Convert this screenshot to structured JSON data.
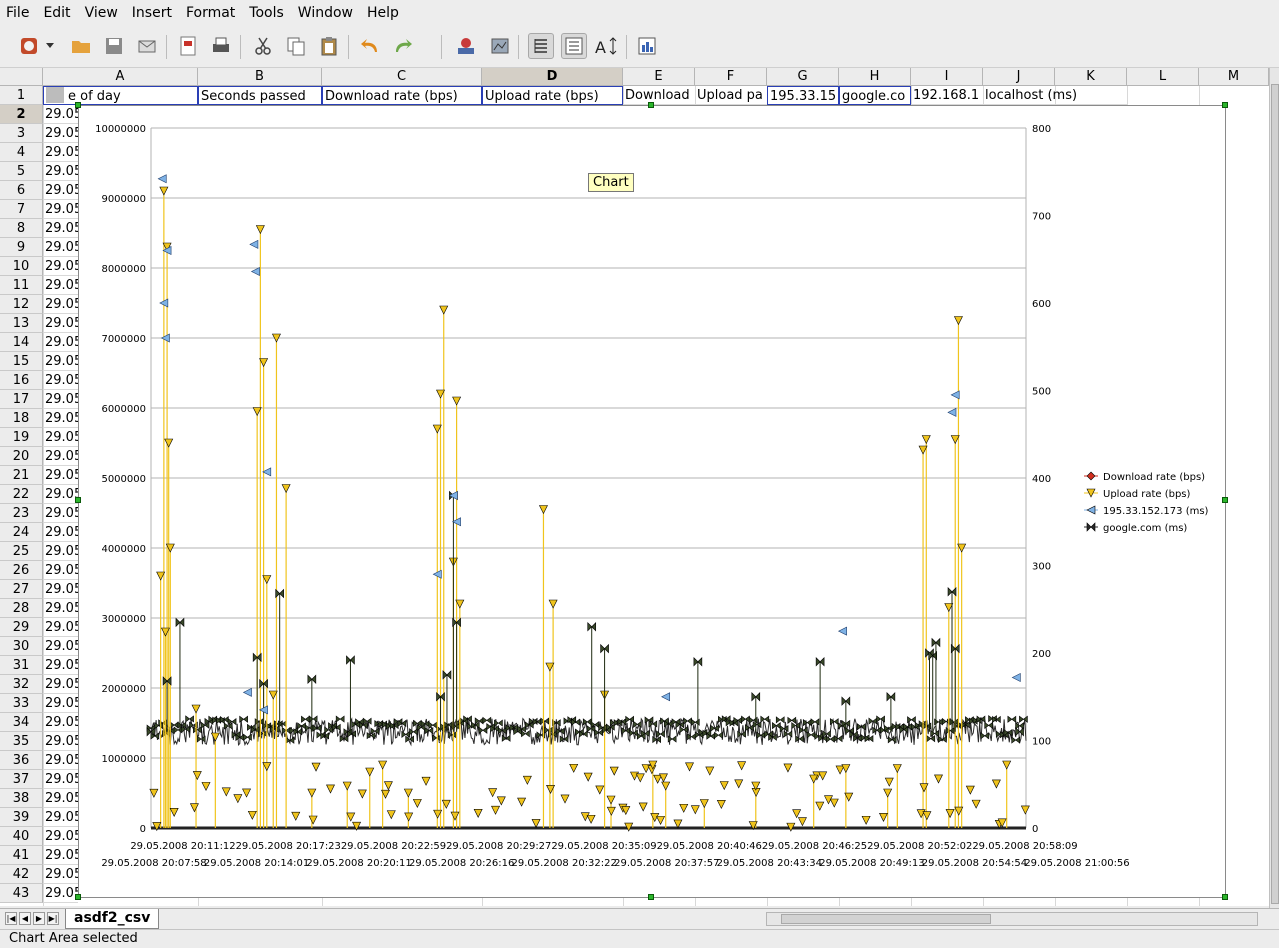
{
  "menu": [
    "File",
    "Edit",
    "View",
    "Insert",
    "Format",
    "Tools",
    "Window",
    "Help"
  ],
  "toolbar": {
    "icons": [
      "new-document",
      "dropdown",
      "open",
      "save",
      "mail",
      "export-pdf",
      "print",
      "cut",
      "copy",
      "paste",
      "undo",
      "redo",
      "insert-image",
      "gallery",
      "data-table",
      "data-labels",
      "scale-text",
      "chart-type"
    ]
  },
  "columns": [
    {
      "letter": "A",
      "header1": "e of day"
    },
    {
      "letter": "B",
      "header1": "Seconds passed"
    },
    {
      "letter": "C",
      "header1": "Download rate (bps)"
    },
    {
      "letter": "D",
      "header1": "Upload rate (bps)"
    },
    {
      "letter": "E",
      "header1": "Download"
    },
    {
      "letter": "F",
      "header1": "Upload pa"
    },
    {
      "letter": "G",
      "header1": "195.33.15"
    },
    {
      "letter": "H",
      "header1": "google.co"
    },
    {
      "letter": "I",
      "header1": "192.168.1"
    },
    {
      "letter": "J",
      "header1": "localhost (ms)"
    },
    {
      "letter": "K",
      "header1": ""
    },
    {
      "letter": "L",
      "header1": ""
    },
    {
      "letter": "M",
      "header1": ""
    }
  ],
  "rows": [
    "1",
    "2",
    "3",
    "4",
    "5",
    "6",
    "7",
    "8",
    "9",
    "10",
    "11",
    "12",
    "13",
    "14",
    "15",
    "16",
    "17",
    "18",
    "19",
    "20",
    "21",
    "22",
    "23",
    "24",
    "25",
    "26",
    "27",
    "28",
    "29",
    "30",
    "31",
    "32",
    "33",
    "34",
    "35",
    "36",
    "37",
    "38",
    "39",
    "40",
    "41",
    "42",
    "43"
  ],
  "row_cell_a": "29.05",
  "tooltip": "Chart",
  "sheet_tab": "asdf2_csv",
  "status": "Chart Area selected",
  "chart_data": {
    "type": "line",
    "x_tick_labels_top": [
      "29.05.2008",
      "20:11:12",
      "29.05.2008",
      "20:17:23",
      "29.05.2008",
      "20:22:59",
      "29.05.2008",
      "20:29:27",
      "29.05.2008",
      "20:35:09",
      "29.05.2008",
      "20:40:46",
      "29.05.2008",
      "20:46:25",
      "29.05.2008",
      "20:52:02",
      "29.05.2008",
      "20:58:09"
    ],
    "x_tick_labels_bottom": [
      "29.05.2008",
      "20:07:58",
      "29.05.2008",
      "20:14:01",
      "29.05.2008",
      "20:20:11",
      "29.05.2008",
      "20:26:16",
      "29.05.2008",
      "20:32:22",
      "29.05.2008",
      "20:37:57",
      "29.05.2008",
      "20:43:34",
      "29.05.2008",
      "20:49:13",
      "29.05.2008",
      "20:54:54",
      "29.05.2008",
      "21:00:56"
    ],
    "y_left_ticks": [
      "10000000",
      "9000000",
      "8000000",
      "7000000",
      "6000000",
      "5000000",
      "4000000",
      "3000000",
      "2000000",
      "1000000",
      "0"
    ],
    "y_right_ticks": [
      "800",
      "700",
      "600",
      "500",
      "400",
      "300",
      "200",
      "100",
      "0"
    ],
    "ylim_left": [
      0,
      10000000
    ],
    "ylim_right": [
      0,
      800
    ],
    "legend_position": "right",
    "grid": true,
    "series": [
      {
        "name": "Download rate (bps)",
        "axis": "left",
        "color": "#d22e1e",
        "marker": "diamond",
        "values": [
          0,
          0,
          0,
          0,
          0,
          0,
          0,
          0,
          0,
          0,
          0,
          0,
          0,
          0,
          0,
          0,
          0,
          0,
          0,
          0
        ]
      },
      {
        "name": "Upload rate (bps)",
        "axis": "left",
        "color": "#f0c41c",
        "marker": "triangle-down",
        "points": [
          [
            0.4,
            9100000
          ],
          [
            0.5,
            8300000
          ],
          [
            0.55,
            5500000
          ],
          [
            0.6,
            4000000
          ],
          [
            0.3,
            3600000
          ],
          [
            0.45,
            2800000
          ],
          [
            3.4,
            8550000
          ],
          [
            3.3,
            5950000
          ],
          [
            3.5,
            6650000
          ],
          [
            3.6,
            3550000
          ],
          [
            3.9,
            7000000
          ],
          [
            3.8,
            1900000
          ],
          [
            4.2,
            4850000
          ],
          [
            9.1,
            7400000
          ],
          [
            8.9,
            5700000
          ],
          [
            9.0,
            6200000
          ],
          [
            9.5,
            6100000
          ],
          [
            9.6,
            3200000
          ],
          [
            9.4,
            3800000
          ],
          [
            12.2,
            4550000
          ],
          [
            12.5,
            3200000
          ],
          [
            12.4,
            2300000
          ],
          [
            14.1,
            1900000
          ],
          [
            14.3,
            400000
          ],
          [
            24.1,
            5550000
          ],
          [
            24.0,
            5400000
          ],
          [
            25.1,
            7250000
          ],
          [
            25.0,
            5550000
          ],
          [
            25.2,
            4000000
          ],
          [
            24.8,
            3150000
          ],
          [
            26.6,
            900000
          ],
          [
            15.6,
            900000
          ],
          [
            16.0,
            600000
          ],
          [
            20.6,
            700000
          ],
          [
            21.6,
            850000
          ],
          [
            17.2,
            350000
          ],
          [
            18.8,
            600000
          ],
          [
            5.0,
            500000
          ],
          [
            6.1,
            600000
          ],
          [
            7.2,
            900000
          ],
          [
            8.0,
            500000
          ],
          [
            23.2,
            850000
          ],
          [
            22.9,
            500000
          ],
          [
            1.4,
            1700000
          ],
          [
            6.8,
            800000
          ],
          [
            2.0,
            1300000
          ]
        ]
      },
      {
        "name": "195.33.152.173 (ms)",
        "axis": "right",
        "color": "#7fb2e5",
        "marker": "triangle-left",
        "points": [
          [
            0.35,
            742
          ],
          [
            0.4,
            600
          ],
          [
            0.45,
            560
          ],
          [
            0.5,
            660
          ],
          [
            3.2,
            667
          ],
          [
            3.25,
            636
          ],
          [
            3.6,
            407
          ],
          [
            3.5,
            135
          ],
          [
            8.9,
            290
          ],
          [
            9.5,
            350
          ],
          [
            9.4,
            380
          ],
          [
            16.0,
            150
          ],
          [
            21.5,
            225
          ],
          [
            25.0,
            495
          ],
          [
            24.9,
            475
          ],
          [
            26.9,
            172
          ],
          [
            3.0,
            155
          ]
        ]
      },
      {
        "name": "google.com (ms)",
        "axis": "right",
        "color": "#2a2a2a",
        "marker": "bowtie",
        "points": [
          [
            0.5,
            168
          ],
          [
            0.9,
            235
          ],
          [
            3.3,
            195
          ],
          [
            3.5,
            165
          ],
          [
            4.0,
            268
          ],
          [
            5.0,
            170
          ],
          [
            6.2,
            192
          ],
          [
            9.4,
            380
          ],
          [
            9.5,
            235
          ],
          [
            9.2,
            175
          ],
          [
            9.0,
            150
          ],
          [
            13.7,
            230
          ],
          [
            14.1,
            205
          ],
          [
            17.0,
            190
          ],
          [
            18.8,
            150
          ],
          [
            20.8,
            190
          ],
          [
            21.6,
            145
          ],
          [
            23.0,
            150
          ],
          [
            24.2,
            200
          ],
          [
            24.3,
            197
          ],
          [
            24.4,
            212
          ],
          [
            24.9,
            270
          ],
          [
            25.0,
            205
          ],
          [
            0,
            110
          ],
          [
            27,
            110
          ]
        ]
      }
    ]
  }
}
